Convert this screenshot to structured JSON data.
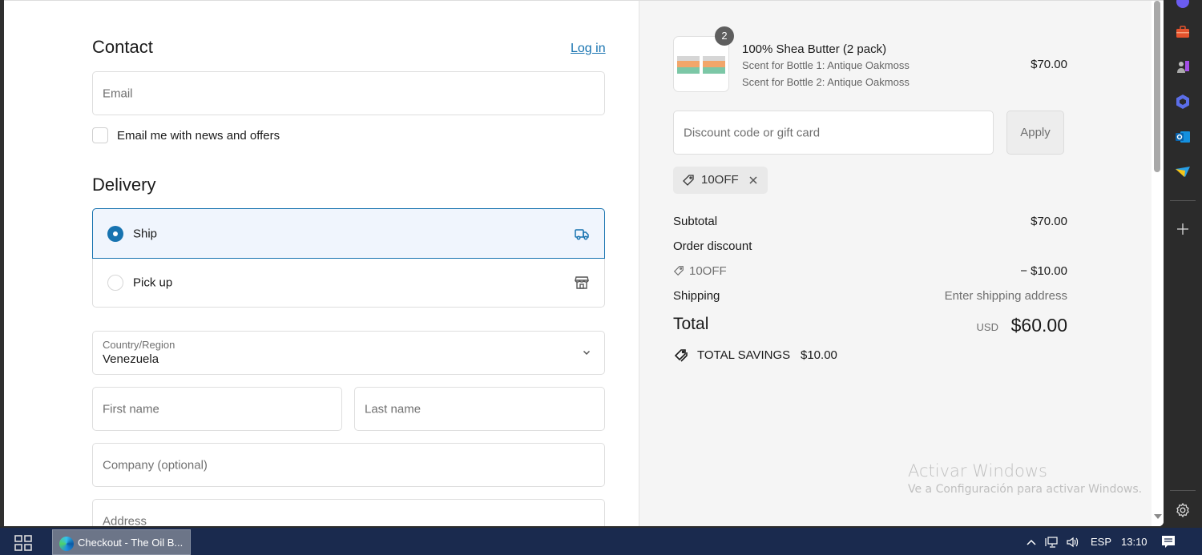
{
  "contact": {
    "heading": "Contact",
    "login_link": "Log in",
    "email_placeholder": "Email",
    "newsletter_label": "Email me with news and offers",
    "newsletter_checked": false
  },
  "delivery": {
    "heading": "Delivery",
    "options": [
      {
        "label": "Ship",
        "selected": true,
        "icon": "truck-icon"
      },
      {
        "label": "Pick up",
        "selected": false,
        "icon": "store-icon"
      }
    ],
    "country_label": "Country/Region",
    "country_value": "Venezuela",
    "first_name_placeholder": "First name",
    "last_name_placeholder": "Last name",
    "company_placeholder": "Company (optional)",
    "address_placeholder": "Address"
  },
  "summary": {
    "product": {
      "title": "100% Shea Butter (2 pack)",
      "quantity": "2",
      "variants": [
        "Scent for Bottle 1: Antique Oakmoss",
        "Scent for Bottle 2: Antique Oakmoss"
      ],
      "price": "$70.00"
    },
    "discount_placeholder": "Discount code or gift card",
    "apply_label": "Apply",
    "applied_code": "10OFF",
    "subtotal_label": "Subtotal",
    "subtotal_value": "$70.00",
    "order_discount_label": "Order discount",
    "discount_code": "10OFF",
    "discount_value": "− $10.00",
    "shipping_label": "Shipping",
    "shipping_value": "Enter shipping address",
    "total_label": "Total",
    "total_currency": "USD",
    "total_value": "$60.00",
    "savings_label": "TOTAL SAVINGS",
    "savings_value": "$10.00"
  },
  "watermark": {
    "title": "Activar Windows",
    "subtitle": "Ve a Configuración para activar Windows."
  },
  "sidebar_icons": [
    "copilot-icon",
    "tools-icon",
    "games-icon",
    "microsoft365-icon",
    "outlook-icon",
    "send-icon",
    "add-icon",
    "settings-icon"
  ],
  "taskbar": {
    "app_title": "Checkout - The Oil B...",
    "language": "ESP",
    "time": "13:10"
  },
  "colors": {
    "accent": "#1773b0",
    "summary_bg": "#f5f5f5",
    "taskbar": "#1a2a4e"
  }
}
